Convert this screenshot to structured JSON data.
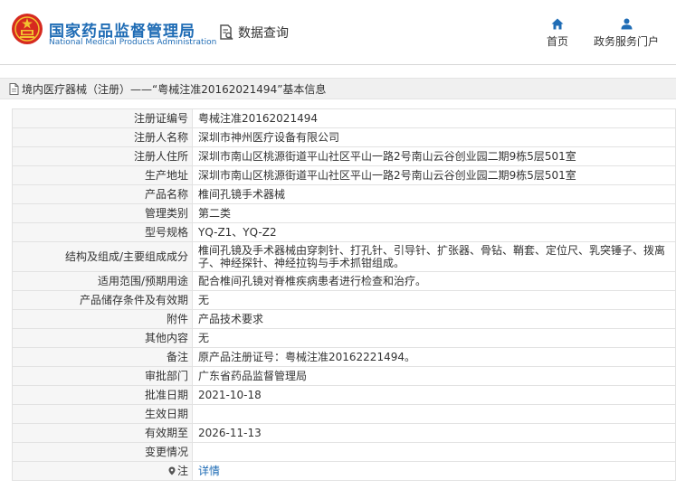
{
  "header": {
    "brand_cn": "国家药品监督管理局",
    "brand_en": "National Medical Products Administration",
    "query_label": "数据查询",
    "nav": {
      "home_label": "首页",
      "portal_label": "政务服务门户"
    },
    "colors": {
      "brand": "#1f6cb5",
      "emblem_red": "#d62a20",
      "emblem_gold": "#f2c230"
    }
  },
  "breadcrumb": {
    "text": "境内医疗器械（注册）——“粤械注准20162021494”基本信息"
  },
  "details": {
    "rows": [
      {
        "label": "注册证编号",
        "value": "粤械注准20162021494"
      },
      {
        "label": "注册人名称",
        "value": "深圳市神州医疗设备有限公司"
      },
      {
        "label": "注册人住所",
        "value": "深圳市南山区桃源街道平山社区平山一路2号南山云谷创业园二期9栋5层501室"
      },
      {
        "label": "生产地址",
        "value": "深圳市南山区桃源街道平山社区平山一路2号南山云谷创业园二期9栋5层501室"
      },
      {
        "label": "产品名称",
        "value": "椎间孔镜手术器械"
      },
      {
        "label": "管理类别",
        "value": "第二类"
      },
      {
        "label": "型号规格",
        "value": "YQ-Z1、YQ-Z2"
      },
      {
        "label": "结构及组成/主要组成成分",
        "value": "椎间孔镜及手术器械由穿刺针、打孔针、引导针、扩张器、骨钻、鞘套、定位尺、乳突锤子、拨离子、神经探针、神经拉钩与手术抓钳组成。"
      },
      {
        "label": "适用范围/预期用途",
        "value": "配合椎间孔镜对脊椎疾病患者进行检查和治疗。"
      },
      {
        "label": "产品储存条件及有效期",
        "value": "无"
      },
      {
        "label": "附件",
        "value": "产品技术要求"
      },
      {
        "label": "其他内容",
        "value": "无"
      },
      {
        "label": "备注",
        "value": "原产品注册证号：粤械注准20162221494。"
      },
      {
        "label": "审批部门",
        "value": "广东省药品监督管理局"
      },
      {
        "label": "批准日期",
        "value": "2021-10-18"
      },
      {
        "label": "生效日期",
        "value": ""
      },
      {
        "label": "有效期至",
        "value": "2026-11-13"
      },
      {
        "label": "变更情况",
        "value": ""
      }
    ],
    "note": {
      "label": "注",
      "link_text": "详情"
    }
  }
}
